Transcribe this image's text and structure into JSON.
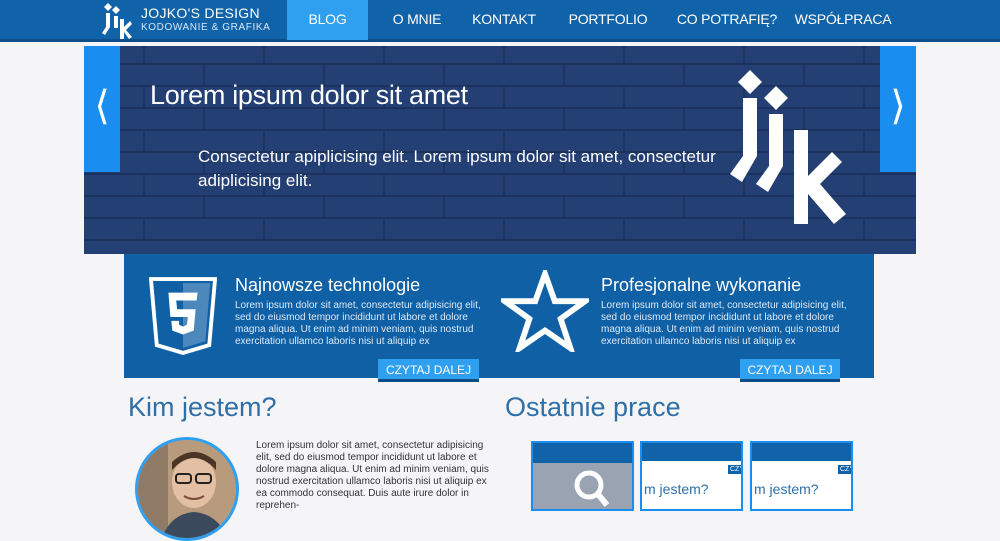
{
  "header": {
    "brand_title": "JOJKO'S DESIGN",
    "brand_subtitle": "KODOWANIE & GRAFIKA",
    "nav": [
      "BLOG",
      "O MNIE",
      "KONTAKT",
      "PORTFOLIO",
      "CO POTRAFIĘ?",
      "WSPÓŁPRACA"
    ],
    "active_nav": "BLOG"
  },
  "slider": {
    "title": "Lorem ipsum dolor sit amet",
    "text": "Consectetur apiplicising elit. Lorem ipsum dolor sit amet, consectetur adiplicising elit.",
    "prev": "⟨",
    "next": "⟩"
  },
  "features": [
    {
      "icon": "html5-icon",
      "title": "Najnowsze technologie",
      "text": "Lorem ipsum dolor sit amet, consectetur adipisicing elit, sed do eiusmod tempor incididunt ut labore et dolore magna aliqua. Ut enim ad minim veniam, quis nostrud exercitation ullamco laboris nisi ut aliquip ex",
      "button": "CZYTAJ DALEJ"
    },
    {
      "icon": "star-icon",
      "title": "Profesjonalne wykonanie",
      "text": "Lorem ipsum dolor sit amet, consectetur adipisicing elit, sed do eiusmod tempor incididunt ut labore et dolore magna aliqua. Ut enim ad minim veniam, quis nostrud exercitation ullamco laboris nisi ut aliquip ex",
      "button": "CZYTAJ DALEJ"
    }
  ],
  "about": {
    "title": "Kim jestem?",
    "text": "Lorem ipsum dolor sit amet, consectetur adipisicing elit, sed do eiusmod tempor incididunt ut labore et dolore magna aliqua. Ut enim ad minim veniam, quis nostrud exercitation ullamco laboris nisi ut aliquip ex ea commodo consequat. Duis aute irure dolor in reprehen-"
  },
  "recent": {
    "title": "Ostatnie prace",
    "thumb_label": "m jestem?",
    "thumb_tag": "CZY"
  },
  "colors": {
    "nav_bg": "#1163a9",
    "accent": "#2f9ff0",
    "feature_bg": "#1060a6",
    "slider_bg": "#233d72",
    "heading": "#2f6fa8"
  }
}
